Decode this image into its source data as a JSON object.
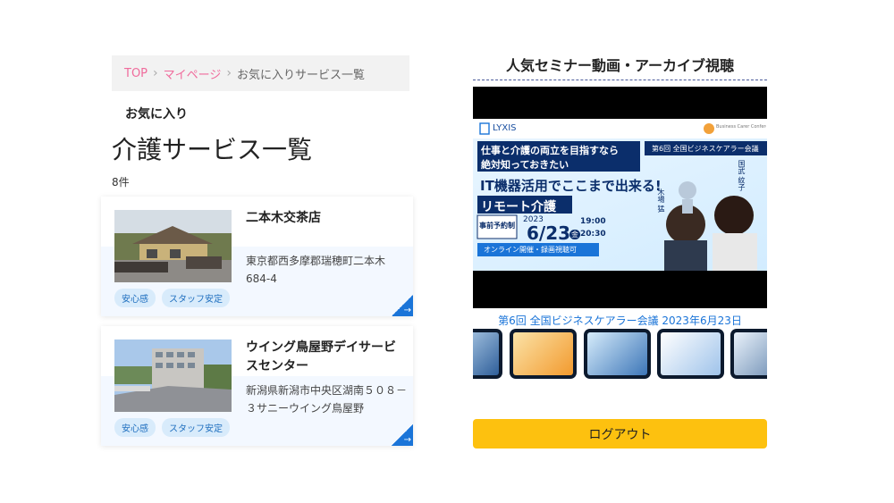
{
  "breadcrumb": {
    "items": [
      {
        "label": "TOP"
      },
      {
        "label": "マイページ"
      },
      {
        "label": "お気に入りサービス一覧"
      }
    ],
    "separator": "›"
  },
  "page": {
    "subtitle": "お気に入り",
    "title": "介護サービス一覧",
    "count": "8件"
  },
  "services": [
    {
      "name": "二本木交茶店",
      "address": "東京都西多摩郡瑞穂町二本木684-4",
      "tags": [
        "安心感",
        "スタッフ安定"
      ]
    },
    {
      "name": "ウイング鳥屋野デイサービスセンター",
      "address": "新潟県新潟市中央区湖南５０８－３サニーウイング鳥屋野",
      "tags": [
        "安心感",
        "スタッフ安定"
      ]
    }
  ],
  "seminar": {
    "section_title": "人気セミナー動画・アーカイブ視聴",
    "video": {
      "logo": "LYXIS",
      "conference": "Business Carer Conference",
      "headline1": "仕事と介護の両立を目指すなら",
      "headline2": "絶対知っておきたい",
      "badge": "第6回 全国ビジネスケアラー会議",
      "title1": "IT機器活用でここまで出来る!",
      "title2": "リモート介護",
      "reservation": "事前予約制",
      "year": "2023",
      "date": "6/23",
      "weekday": "金",
      "time_start": "19:00",
      "time_end": "20:30",
      "online": "オンライン開催・録画視聴可",
      "speaker1": "国武 紋子",
      "speaker2": "木場 猛"
    },
    "caption": "第6回 全国ビジネスケアラー会議 2023年6月23日"
  },
  "logout_label": "ログアウト",
  "colors": {
    "breadcrumb_link": "#f06b9c",
    "accent_blue": "#1a74d8",
    "logout_yellow": "#fdc10f"
  }
}
